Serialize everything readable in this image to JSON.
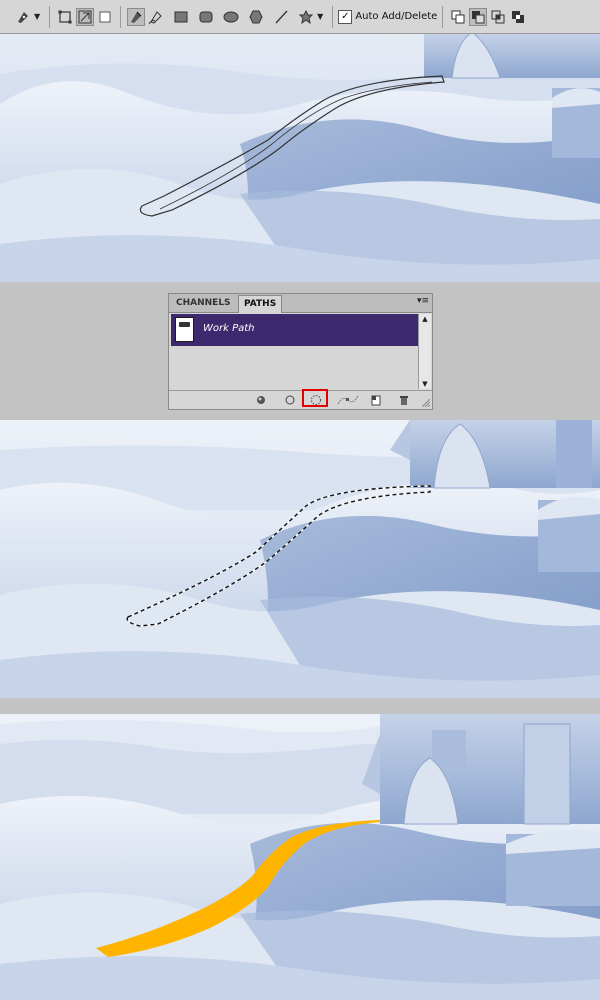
{
  "toolbar": {
    "tools": [
      {
        "name": "pen-tool-preset",
        "icon": "pen-icon"
      },
      {
        "name": "shape-layers",
        "icon": "shape-layers-icon"
      },
      {
        "name": "paths-mode",
        "icon": "paths-mode-icon"
      },
      {
        "name": "fill-pixels",
        "icon": "fill-pixels-icon"
      },
      {
        "name": "pen-tool",
        "icon": "pen-icon"
      },
      {
        "name": "freeform-pen-tool",
        "icon": "freeform-pen-icon"
      },
      {
        "name": "rectangle-tool",
        "icon": "rectangle-icon"
      },
      {
        "name": "rounded-rectangle-tool",
        "icon": "rounded-rectangle-icon"
      },
      {
        "name": "ellipse-tool",
        "icon": "ellipse-icon"
      },
      {
        "name": "polygon-tool",
        "icon": "polygon-icon"
      },
      {
        "name": "line-tool",
        "icon": "line-icon"
      },
      {
        "name": "custom-shape-tool",
        "icon": "custom-shape-icon"
      }
    ],
    "auto_add_delete": {
      "label": "Auto Add/Delete",
      "checked": true,
      "check_mark": "✓"
    },
    "path_operations": [
      "add-to-path-area",
      "subtract-from-path-area",
      "intersect-path-areas",
      "exclude-overlapping-path-areas"
    ],
    "dropdown_glyph": "▼"
  },
  "panel": {
    "tabs": [
      {
        "label": "CHANNELS",
        "active": false
      },
      {
        "label": "PATHS",
        "active": true
      }
    ],
    "menu_glyph": "▾≡",
    "items": [
      {
        "name": "Work Path",
        "selected": true
      }
    ],
    "scroll_up": "▲",
    "scroll_down": "▼",
    "footer_buttons": [
      {
        "name": "fill-path-button",
        "icon": "fill-path-icon"
      },
      {
        "name": "stroke-path-button",
        "icon": "stroke-path-icon"
      },
      {
        "name": "load-path-as-selection-button",
        "icon": "selection-icon",
        "highlighted": true
      },
      {
        "name": "make-work-path-button",
        "icon": "work-path-icon"
      },
      {
        "name": "new-path-button",
        "icon": "new-path-icon"
      },
      {
        "name": "delete-path-button",
        "icon": "trash-icon"
      }
    ]
  },
  "colors": {
    "path_selected": "#3d2a6e",
    "highlight_box": "#e00000",
    "road_fill": "#ffb400",
    "snow_light": "#dfe7f3",
    "snow_shadow": "#7c98c6"
  }
}
